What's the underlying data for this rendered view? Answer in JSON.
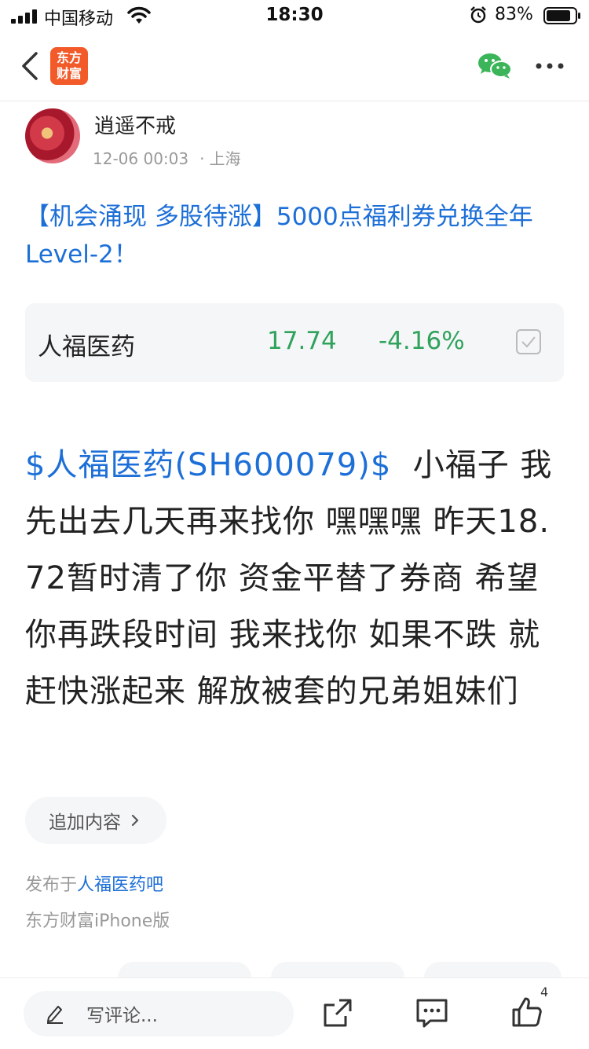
{
  "status_bar": {
    "carrier": "中国移动",
    "time": "18:30",
    "battery": "83%"
  },
  "nav": {
    "logo_line1": "东方",
    "logo_line2": "财富",
    "brand_color": "#f25a29"
  },
  "author": {
    "name": "逍遥不戒",
    "time": "12-06 00:03",
    "location": "上海"
  },
  "post": {
    "title": "【机会涌现 多股待涨】5000点福利券兑换全年Level-2！",
    "stock_tag": "$人福医药(SH600079)$",
    "body": "  小福子 我先出去几天再来找你 嘿嘿嘿 昨天18.72暂时清了你 资金平替了券商 希望你再跌段时间 我来找你 如果不跌 就赶快涨起来 解放被套的兄弟姐妹们"
  },
  "stock_card": {
    "name": "人福医药",
    "price": "17.74",
    "change": "-4.16%",
    "color_down": "#2fa25b"
  },
  "append": {
    "label": "追加内容"
  },
  "meta": {
    "published_prefix": "发布于",
    "bar_name": "人福医药吧",
    "client": "东方财富iPhone版"
  },
  "bottom_bar": {
    "comment_placeholder": "写评论...",
    "like_count": "4"
  },
  "colors": {
    "link_blue": "#1d6fd8",
    "muted": "#999999"
  }
}
